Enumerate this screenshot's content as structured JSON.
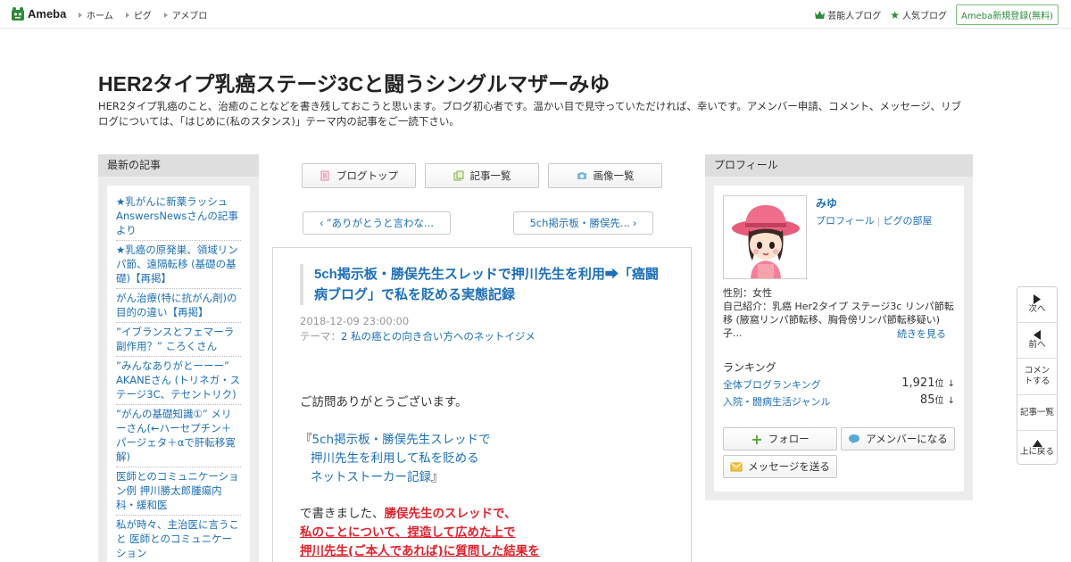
{
  "header": {
    "logo_text": "Ameba",
    "nav": [
      "ホーム",
      "ピグ",
      "アメブロ"
    ],
    "right_links": [
      {
        "label": "芸能人ブログ",
        "icon": "crown-icon"
      },
      {
        "label": "人気ブログ",
        "icon": "star-icon"
      }
    ],
    "signup_label": "Ameba新規登録(無料)",
    "accent": "#2d8c3c"
  },
  "blog": {
    "title": "HER2タイプ乳癌ステージ3Cと闘うシングルマザーみゆ",
    "description": "HER2タイプ乳癌のこと、治癒のことなどを書き残しておこうと思います。ブログ初心者です。温かい目で見守っていただければ、幸いです。アメンバー申請、コメント、メッセージ、リブログについては、「はじめに(私のスタンス)」テーマ内の記事をご一読下さい。"
  },
  "left_sidebar": {
    "heading": "最新の記事",
    "items": [
      "★乳がんに新薬ラッシュ AnswersNewsさんの記事より",
      "★乳癌の原発巣、領域リンパ節、遠隔転移 (基礎の基礎)【再掲】",
      "がん治療(特に抗がん剤)の目的の違い【再掲】",
      "”イブランスとフェマーラ副作用？” ころくさん",
      "”みんなありがとーーー” AKANEさん (トリネガ・ステージ3C、テセントリク)",
      "”がんの基礎知識①” メリーさん(←ハーセプチン＋パージェタ＋αで肝転移寛解)",
      "医師とのコミュニケーション例 押川勝太郎腫瘍内科・緩和医",
      "私が時々、主治医に言うこと 医師とのコミュニケーション"
    ]
  },
  "center": {
    "buttons": [
      {
        "label": "ブログトップ",
        "icon": "blog-top-icon"
      },
      {
        "label": "記事一覧",
        "icon": "entry-list-icon"
      },
      {
        "label": "画像一覧",
        "icon": "camera-icon"
      }
    ],
    "prev_entry": "”ありがとうと言わな...",
    "next_entry": "5ch掲示板・勝俣先...",
    "entry": {
      "title": "5ch掲示板・勝俣先生スレッドで押川先生を利用➡「癌闘病ブログ」で私を貶める実態記録",
      "date": "2018-12-09 23:00:00",
      "theme_label": "テーマ：",
      "theme": "2 私の癌との向き合い方へのネットイジメ",
      "greeting": "ご訪問ありがとうございます。",
      "quote_open": "『",
      "quote_lines": [
        "5ch掲示板・勝俣先生スレッドで",
        "押川先生を利用して私を貶める",
        "ネットストーカー記録"
      ],
      "quote_close": "』",
      "wrote_prefix": "で書きました、",
      "red_1": "勝俣先生のスレッドで、",
      "red_2": "私のことについて、捏造して広めた上で",
      "red_3": "押川先生(ご本人であれば)に質問した結果を"
    }
  },
  "right_sidebar": {
    "heading": "プロフィール",
    "name": "みゆ",
    "links": [
      "プロフィール",
      "ピグの部屋"
    ],
    "gender": "性別：女性",
    "intro": "自己紹介：乳癌 Her2タイプ ステージ3c リンパ節転移 (腋窩リンパ節転移、胸骨傍リンパ節転移疑い) 子...",
    "more_label": "続きを見る",
    "ranking_heading": "ランキング",
    "rankings": [
      {
        "label": "全体ブログランキング",
        "value": "1,921",
        "unit": "位",
        "arrow": "↓"
      },
      {
        "label": "入院・闘病生活ジャンル",
        "value": "85",
        "unit": "位",
        "arrow": "↓"
      }
    ],
    "follow_label": "フォロー",
    "amember_label": "アメンバーになる",
    "message_label": "メッセージを送る"
  },
  "float_nav": [
    {
      "label": "次へ",
      "icon": "arrow-right-icon"
    },
    {
      "label": "前へ",
      "icon": "arrow-left-icon"
    },
    {
      "label": "コメントする",
      "icon": ""
    },
    {
      "label": "記事一覧",
      "icon": ""
    },
    {
      "label": "上に戻る",
      "icon": "arrow-up-icon"
    }
  ]
}
